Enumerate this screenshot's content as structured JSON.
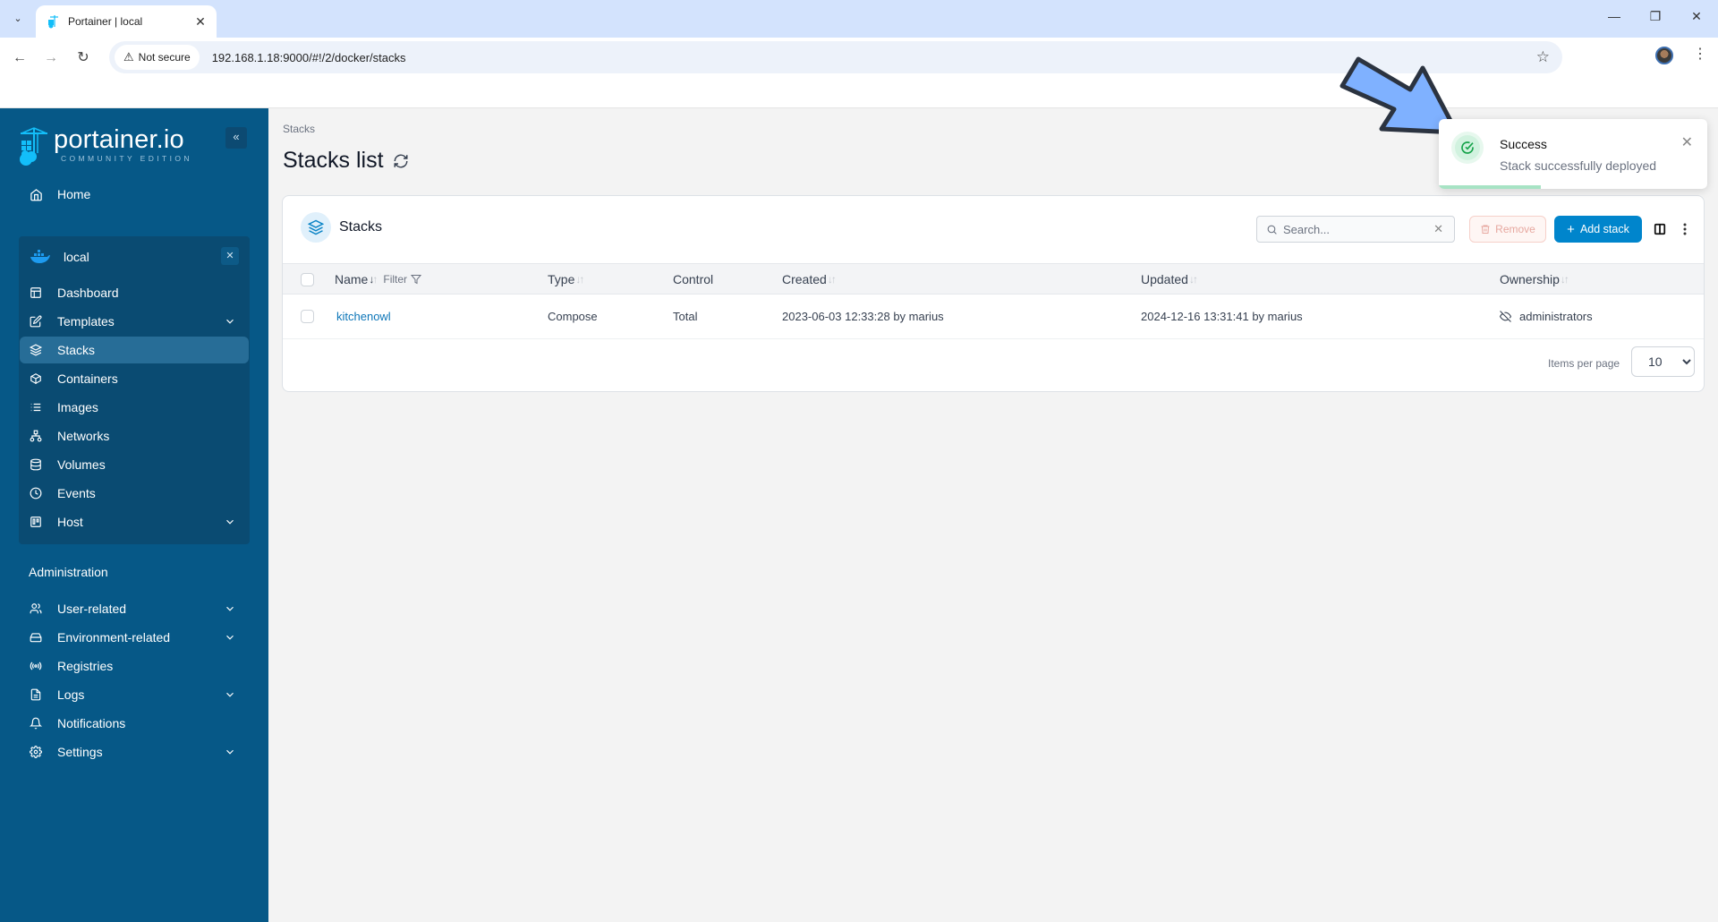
{
  "browser": {
    "tab_title": "Portainer | local",
    "security_label": "Not secure",
    "url": "192.168.1.18:9000/#!/2/docker/stacks"
  },
  "sidebar": {
    "logo_main": "portainer.io",
    "logo_sub": "COMMUNITY EDITION",
    "home_label": "Home",
    "environment": {
      "name": "local",
      "items": [
        {
          "label": "Dashboard",
          "icon": "dashboard-icon",
          "expandable": false,
          "active": false
        },
        {
          "label": "Templates",
          "icon": "edit-icon",
          "expandable": true,
          "active": false
        },
        {
          "label": "Stacks",
          "icon": "layers-icon",
          "expandable": false,
          "active": true
        },
        {
          "label": "Containers",
          "icon": "box-icon",
          "expandable": false,
          "active": false
        },
        {
          "label": "Images",
          "icon": "list-icon",
          "expandable": false,
          "active": false
        },
        {
          "label": "Networks",
          "icon": "network-icon",
          "expandable": false,
          "active": false
        },
        {
          "label": "Volumes",
          "icon": "database-icon",
          "expandable": false,
          "active": false
        },
        {
          "label": "Events",
          "icon": "clock-icon",
          "expandable": false,
          "active": false
        },
        {
          "label": "Host",
          "icon": "host-icon",
          "expandable": true,
          "active": false
        }
      ]
    },
    "admin_heading": "Administration",
    "admin_items": [
      {
        "label": "User-related",
        "icon": "users-icon",
        "expandable": true
      },
      {
        "label": "Environment-related",
        "icon": "hard-drive-icon",
        "expandable": true
      },
      {
        "label": "Registries",
        "icon": "radio-icon",
        "expandable": false
      },
      {
        "label": "Logs",
        "icon": "file-text-icon",
        "expandable": true
      },
      {
        "label": "Notifications",
        "icon": "bell-icon",
        "expandable": false
      },
      {
        "label": "Settings",
        "icon": "gear-icon",
        "expandable": true
      }
    ]
  },
  "main": {
    "breadcrumb": "Stacks",
    "page_title": "Stacks list",
    "card_title": "Stacks",
    "search_placeholder": "Search...",
    "remove_label": "Remove",
    "add_label": "Add stack",
    "columns": {
      "name": "Name",
      "filter": "Filter",
      "type": "Type",
      "control": "Control",
      "created": "Created",
      "updated": "Updated",
      "ownership": "Ownership"
    },
    "rows": [
      {
        "name": "kitchenowl",
        "type": "Compose",
        "control": "Total",
        "created": "2023-06-03 12:33:28 by marius",
        "updated": "2024-12-16 13:31:41 by marius",
        "ownership": "administrators"
      }
    ],
    "items_per_page_label": "Items per page",
    "items_per_page": "10"
  },
  "toast": {
    "title": "Success",
    "message": "Stack successfully deployed",
    "progress": 0.38
  },
  "colors": {
    "sidebar_bg": "#065887",
    "accent": "#0085cc",
    "success": "#16a34a"
  }
}
